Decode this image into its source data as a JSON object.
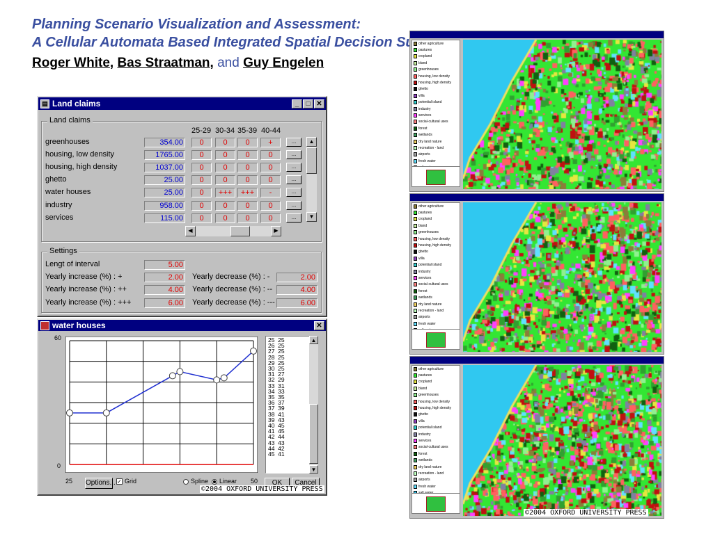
{
  "slide": {
    "title_line1": "Planning Scenario Visualization and Assessment:",
    "title_line2": "A Cellular Automata Based Integrated Spatial Decision Support System",
    "authors": [
      {
        "name": "Roger White"
      },
      {
        "name": "Bas Straatman"
      },
      {
        "name": "Guy Engelen"
      }
    ],
    "sep_comma": ",",
    "and_text": "and",
    "copyright": "©2004 OXFORD UNIVERSITY PRESS"
  },
  "land_claims_window": {
    "title": "Land claims",
    "group_label": "Land claims",
    "columns": [
      "25-29",
      "30-34",
      "35-39",
      "40-44"
    ],
    "rows": [
      {
        "label": "greenhouses",
        "value": "354.00",
        "cells": [
          "0",
          "0",
          "0",
          "+"
        ]
      },
      {
        "label": "housing, low density",
        "value": "1765.00",
        "cells": [
          "0",
          "0",
          "0",
          "0"
        ]
      },
      {
        "label": "housing, high density",
        "value": "1037.00",
        "cells": [
          "0",
          "0",
          "0",
          "0"
        ]
      },
      {
        "label": "ghetto",
        "value": "25.00",
        "cells": [
          "0",
          "0",
          "0",
          "0"
        ]
      },
      {
        "label": "water houses",
        "value": "25.00",
        "cells": [
          "0",
          "+++",
          "+++",
          "-"
        ]
      },
      {
        "label": "industry",
        "value": "958.00",
        "cells": [
          "0",
          "0",
          "0",
          "0"
        ]
      },
      {
        "label": "services",
        "value": "115.00",
        "cells": [
          "0",
          "0",
          "0",
          "0"
        ]
      }
    ],
    "dots_label": "...",
    "settings_label": "Settings",
    "length_label": "Lengt of interval",
    "length_value": "5.00",
    "inc1_label": "Yearly increase (%) : +",
    "inc1_value": "2.00",
    "inc2_label": "Yearly increase (%) : ++",
    "inc2_value": "4.00",
    "inc3_label": "Yearly increase (%) : +++",
    "inc3_value": "6.00",
    "dec1_label": "Yearly decrease (%) : -",
    "dec1_value": "2.00",
    "dec2_label": "Yearly decrease (%) : --",
    "dec2_value": "4.00",
    "dec3_label": "Yearly decrease (%) : ---",
    "dec3_value": "6.00"
  },
  "water_houses_window": {
    "title": "water houses",
    "y_max_label": "60",
    "y_min_label": "0",
    "x_min_label": "25",
    "x_max_label": "50",
    "options_label": "Options...",
    "grid_label": "Grid",
    "spline_label": "Spline",
    "linear_label": "Linear",
    "ok_label": "OK",
    "cancel_label": "Cancel",
    "list": "25  25\n26  25\n27  25\n28  25\n29  25\n30  25\n31  27\n32  29\n33  31\n34  33\n35  35\n36  37\n37  39\n38  41\n39  43\n40  45\n41  45\n42  44\n43  43\n44  42\n45  41",
    "curve": {
      "x": [
        25,
        30,
        39,
        40,
        45,
        46,
        50
      ],
      "y": [
        25,
        25,
        43,
        45,
        41,
        42,
        55
      ],
      "xlim": [
        25,
        50
      ],
      "ylim": [
        0,
        60
      ],
      "grid": true
    }
  },
  "map_legend": [
    {
      "label": "other agriculture",
      "color": "#8b7d3a"
    },
    {
      "label": "pastures",
      "color": "#33e633"
    },
    {
      "label": "cropland",
      "color": "#e6e640"
    },
    {
      "label": "bland",
      "color": "#c8f0a0"
    },
    {
      "label": "greenhouses",
      "color": "#90f090"
    },
    {
      "label": "housing, low density",
      "color": "#ff6060"
    },
    {
      "label": "housing, high density",
      "color": "#c01010"
    },
    {
      "label": "ghetto",
      "color": "#101010"
    },
    {
      "label": "villa",
      "color": "#9040c0"
    },
    {
      "label": "potential island",
      "color": "#30d0d0"
    },
    {
      "label": "industry",
      "color": "#8080a0"
    },
    {
      "label": "services",
      "color": "#ff40ff"
    },
    {
      "label": "social-cultural uses",
      "color": "#ff8080"
    },
    {
      "label": "forest",
      "color": "#106010"
    },
    {
      "label": "wetlands",
      "color": "#40a060"
    },
    {
      "label": "dry land nature",
      "color": "#f0d060"
    },
    {
      "label": "recreation - land",
      "color": "#c0ffc0"
    },
    {
      "label": "airports",
      "color": "#a0a0a0"
    },
    {
      "label": "fresh water",
      "color": "#60e0ff"
    },
    {
      "label": "salt water",
      "color": "#30c8f0"
    }
  ]
}
